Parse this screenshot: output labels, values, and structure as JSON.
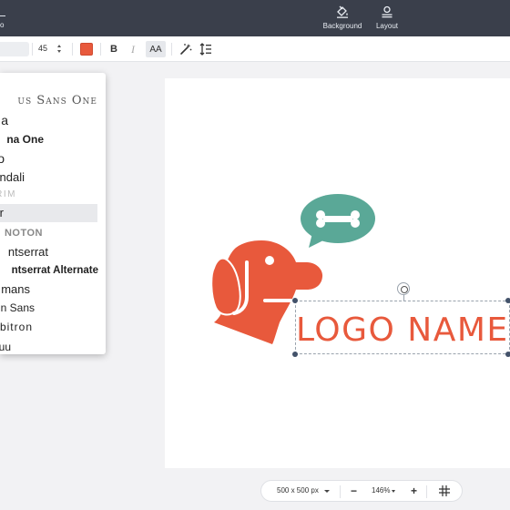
{
  "topbar": {
    "left_label": "o",
    "background_label": "Background",
    "layout_label": "Layout"
  },
  "toolbar": {
    "font_size": "45",
    "text_color": "#e8593c",
    "bold_label": "B",
    "italic_label": "I",
    "case_label": "AA"
  },
  "font_list": [
    {
      "label": "us Sans One"
    },
    {
      "label": "a"
    },
    {
      "label": "na One"
    },
    {
      "label": "o"
    },
    {
      "label": "ndali"
    },
    {
      "label": "RIM"
    },
    {
      "label": "r"
    },
    {
      "label": "NOTON"
    },
    {
      "label": "ntserrat"
    },
    {
      "label": "ntserrat Alternate"
    },
    {
      "label": "mans"
    },
    {
      "label": "n Sans"
    },
    {
      "label": "bitron"
    },
    {
      "label": "uu"
    }
  ],
  "canvas": {
    "logo_text": "LOGO NAME",
    "brand_color": "#e8593c",
    "accent_color": "#5aa897"
  },
  "zoombar": {
    "size_label": "500 x 500 px",
    "zoom_label": "146%",
    "minus_label": "−",
    "plus_label": "+"
  }
}
